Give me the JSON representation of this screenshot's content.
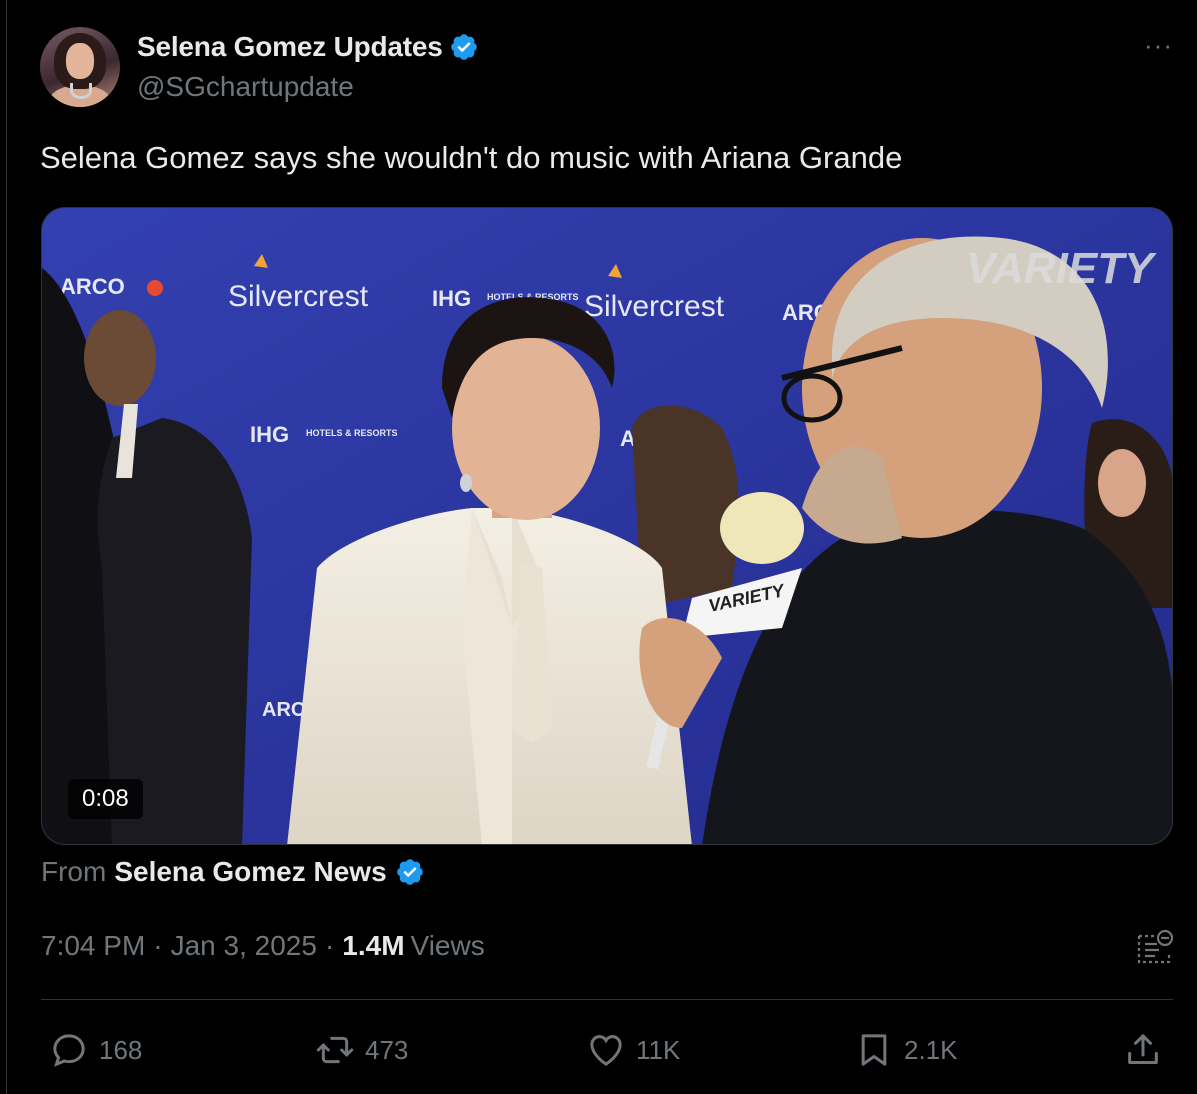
{
  "author": {
    "display_name": "Selena Gomez Updates",
    "handle": "@SGchartupdate",
    "verified": true
  },
  "more_menu": "···",
  "tweet": {
    "text": "Selena Gomez says she wouldn't do music with Ariana Grande"
  },
  "media": {
    "type": "video",
    "duration": "0:08",
    "backdrop_brands": [
      "ARCO",
      "Silvercrest",
      "IHG",
      "HOTELS & RESORTS",
      "Silvercrest",
      "ARCO",
      "IHG",
      "HOTELS & RESORTS",
      "ARC",
      "ARC"
    ],
    "watermark": "VARIETY",
    "mic_flag": "VARIETY"
  },
  "source": {
    "from_label": "From",
    "name": "Selena Gomez News",
    "verified": true
  },
  "meta": {
    "time": "7:04 PM",
    "date": "Jan 3, 2025",
    "views_count": "1.4M",
    "views_label": "Views",
    "separator": "·"
  },
  "actions": {
    "replies": "168",
    "reposts": "473",
    "likes": "11K",
    "bookmarks": "2.1K"
  },
  "colors": {
    "background": "#000000",
    "text_primary": "#e7e9ea",
    "text_secondary": "#71767b",
    "verified_blue": "#1d9bf0",
    "border": "#2f3336"
  }
}
